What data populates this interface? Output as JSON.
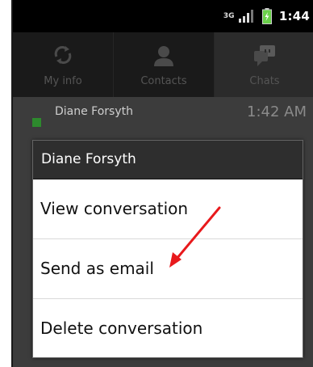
{
  "status_bar": {
    "network": "3G",
    "time": "1:44"
  },
  "tabs": [
    {
      "label": "My info",
      "icon": "sync-icon",
      "selected": false
    },
    {
      "label": "Contacts",
      "icon": "person-icon",
      "selected": false
    },
    {
      "label": "Chats",
      "icon": "chat-bubble-icon",
      "selected": true
    }
  ],
  "chat_list": {
    "items": [
      {
        "name": "Diane Forsyth",
        "time": "1:42 AM",
        "presence_color": "#2d8a2d"
      }
    ]
  },
  "context_menu": {
    "title": "Diane Forsyth",
    "items": [
      {
        "label": "View conversation"
      },
      {
        "label": "Send as email"
      },
      {
        "label": "Delete conversation"
      }
    ]
  },
  "colors": {
    "annotation_arrow": "#e8191c",
    "dialog_title_bg": "#2e2e2e"
  }
}
